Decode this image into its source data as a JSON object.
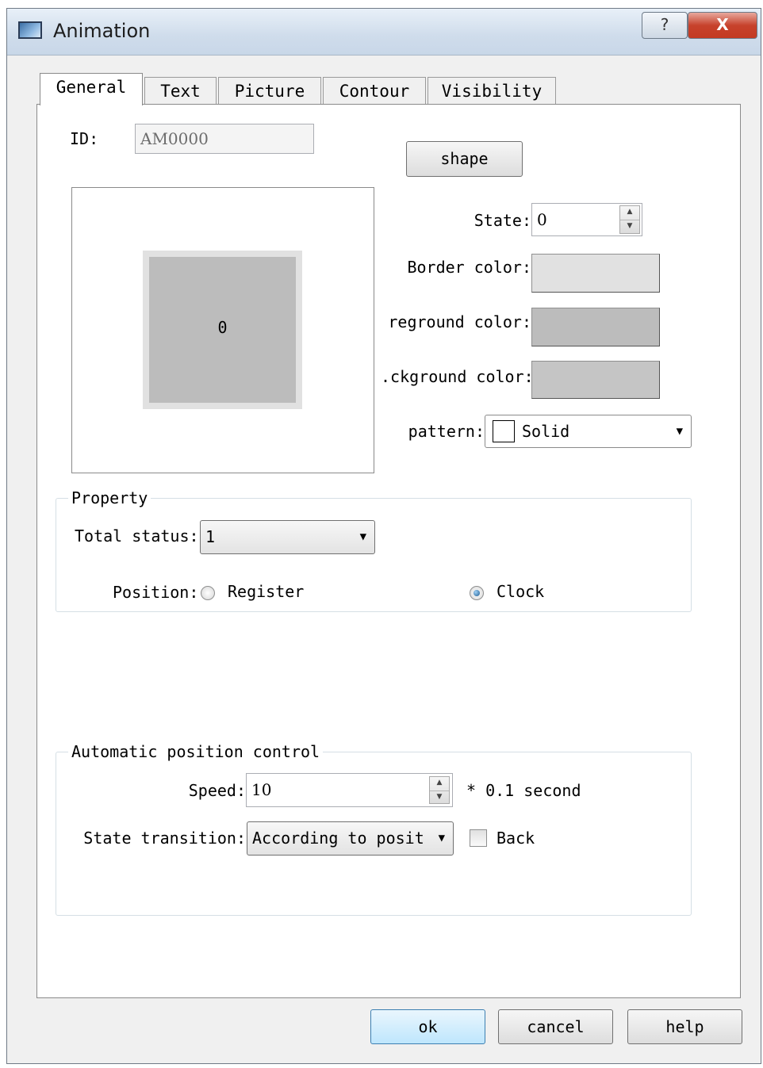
{
  "window": {
    "title": "Animation",
    "help_glyph": "?",
    "close_glyph": "X"
  },
  "tabs": [
    {
      "label": "General",
      "active": true
    },
    {
      "label": "Text",
      "active": false
    },
    {
      "label": "Picture",
      "active": false
    },
    {
      "label": "Contour",
      "active": false
    },
    {
      "label": "Visibility",
      "active": false
    }
  ],
  "general": {
    "id_label": "ID:",
    "id_value": "AM0000",
    "shape_button": "shape",
    "preview_value": "0",
    "state_label": "State:",
    "state_value": "0",
    "border_color_label": "Border color:",
    "border_color": "#e1e1e1",
    "foreground_color_label": "reground color:",
    "foreground_color": "#bcbcbc",
    "background_color_label": ".ckground color:",
    "background_color": "#c5c5c5",
    "pattern_label": "pattern:",
    "pattern_value": "Solid"
  },
  "property": {
    "title": "Property",
    "total_status_label": "Total status:",
    "total_status_value": "1",
    "position_label": "Position:",
    "position_options": [
      {
        "label": "Register",
        "selected": false
      },
      {
        "label": "Clock",
        "selected": true
      }
    ]
  },
  "auto_control": {
    "title": "Automatic position control",
    "speed_label": "Speed:",
    "speed_value": "10",
    "speed_unit": "* 0.1 second",
    "state_transition_label": "State transition:",
    "state_transition_value": "According to posit",
    "back_label": "Back",
    "back_checked": false
  },
  "footer": {
    "ok": "ok",
    "cancel": "cancel",
    "help": "help"
  },
  "icons": {
    "window_icon": "window-icon",
    "spin_up": "▲",
    "spin_down": "▼",
    "dropdown_arrow": "▼"
  }
}
